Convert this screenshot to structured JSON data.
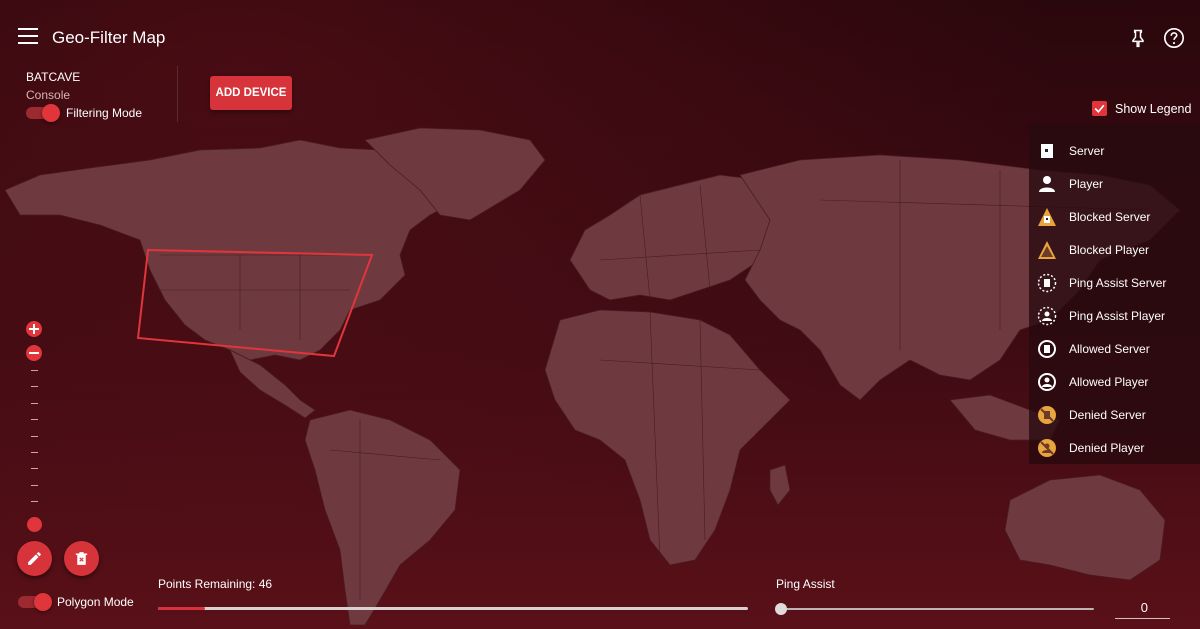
{
  "header": {
    "title": "Geo-Filter Map"
  },
  "device": {
    "name": "BATCAVE",
    "type": "Console",
    "filtering_mode_label": "Filtering Mode",
    "filtering_mode_on": true
  },
  "toolbar": {
    "add_device_label": "ADD DEVICE"
  },
  "legend": {
    "show_label": "Show Legend",
    "checked": true,
    "items": [
      {
        "label": "Server",
        "icon": "server-icon"
      },
      {
        "label": "Player",
        "icon": "player-icon"
      },
      {
        "label": "Blocked Server",
        "icon": "blocked-server-icon"
      },
      {
        "label": "Blocked Player",
        "icon": "blocked-player-icon"
      },
      {
        "label": "Ping Assist Server",
        "icon": "ping-assist-server-icon"
      },
      {
        "label": "Ping Assist Player",
        "icon": "ping-assist-player-icon"
      },
      {
        "label": "Allowed Server",
        "icon": "allowed-server-icon"
      },
      {
        "label": "Allowed Player",
        "icon": "allowed-player-icon"
      },
      {
        "label": "Denied Server",
        "icon": "denied-server-icon"
      },
      {
        "label": "Denied Player",
        "icon": "denied-player-icon"
      }
    ]
  },
  "polygon": {
    "mode_label": "Polygon Mode",
    "mode_on": true,
    "points_label": "Points Remaining: 46",
    "points_fill_fraction": 0.08
  },
  "ping_assist": {
    "label": "Ping Assist",
    "value": "0"
  },
  "colors": {
    "accent": "#e0353b",
    "button": "#d6343a",
    "warning_icon": "#e8a53c",
    "land": "#6e3a40",
    "background": "#3a0a10"
  }
}
